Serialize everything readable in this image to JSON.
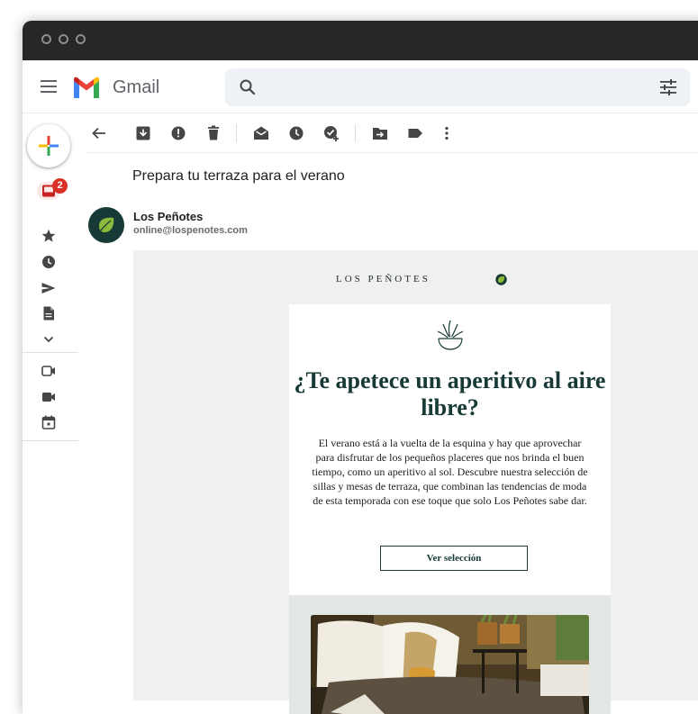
{
  "app": {
    "name": "Gmail"
  },
  "sidebar": {
    "inbox_badge": "2"
  },
  "message": {
    "subject": "Prepara tu terraza para el verano",
    "sender_name": "Los Peñotes",
    "sender_email": "online@lospenotes.com"
  },
  "email": {
    "brand": "LOS PEÑOTES",
    "headline": "¿Te apetece un aperitivo al aire libre?",
    "body": "El verano está a la vuelta de la esquina y hay que aprovechar para disfrutar de los pequeños placeres que nos brinda el buen tiempo, como un aperitivo al sol. Descubre nuestra selección de sillas y mesas de terraza, que combinan las tendencias de moda de esta temporada con ese toque que solo Los Peñotes sabe dar.",
    "cta_label": "Ver selección"
  },
  "colors": {
    "brand_green": "#173a36",
    "badge_red": "#d93025",
    "titlebar": "#272727"
  }
}
